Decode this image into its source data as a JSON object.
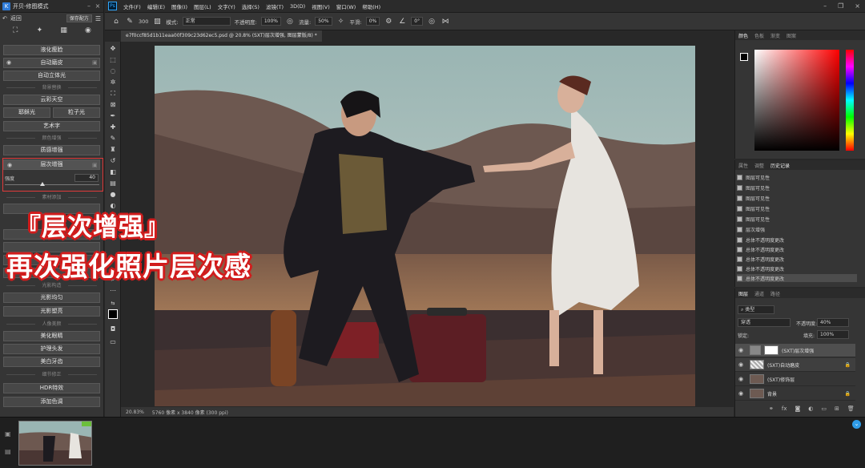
{
  "plugin": {
    "title": "开贝-修图模式",
    "back": "返回",
    "save": "保存配方",
    "buttons": {
      "liquify": "液化瘦脸",
      "skin_smooth": "自动磨皮",
      "auto_3d": "自动立体光",
      "cloud_sky": "云彩天空",
      "glare": "耶稣光",
      "particle": "粒子光",
      "art_text": "艺术字",
      "texture_boost": "质感增强",
      "layer_boost": "层次增强",
      "light_even": "光影均匀",
      "light_shape": "光影塑亮",
      "beautify_eye": "美化眼睛",
      "hair_care": "护理头发",
      "whiten_teeth": "美白牙齿",
      "hdr": "HDR特效",
      "add_tone": "添加色调"
    },
    "sections": {
      "bg": "背景替换",
      "color": "颜色增强",
      "material": "素材添加",
      "light": "光影构造",
      "portrait": "人像美颜",
      "detail": "细节修正"
    },
    "slider": {
      "label": "强度",
      "value": "40",
      "fraction": 0.4
    }
  },
  "ps": {
    "menus": [
      "文件(F)",
      "编辑(E)",
      "图像(I)",
      "图层(L)",
      "文字(Y)",
      "选择(S)",
      "滤镜(T)",
      "3D(D)",
      "视图(V)",
      "窗口(W)",
      "帮助(H)"
    ],
    "options": {
      "mode_label": "模式:",
      "mode_value": "正常",
      "opacity_label": "不透明度:",
      "opacity_value": "100%",
      "flow_label": "流量:",
      "flow_value": "50%",
      "smooth_label": "平滑:",
      "smooth_value": "0%",
      "angle_value": "0°",
      "brush_size": "300"
    },
    "doc_tab": "e7f0ccf85d1b11eaa00f309c23d62ec5.psd @ 20.8% (SXT)层次增强, 图层蒙版/8) *",
    "status": {
      "zoom": "20.83%",
      "size": "5760 像素 x 3840 像素 (300 ppi)"
    }
  },
  "panels": {
    "color_tabs": [
      "颜色",
      "色板",
      "渐变",
      "图案"
    ],
    "history_tabs": [
      "属性",
      "调整",
      "历史记录"
    ],
    "history": [
      "图层可见性",
      "图层可见性",
      "图层可见性",
      "图层可见性",
      "图层可见性",
      "层次增强",
      "总体不透明度更改",
      "总体不透明度更改",
      "总体不透明度更改",
      "总体不透明度更改",
      "总体不透明度更改"
    ],
    "layers_tabs": [
      "图层",
      "通道",
      "路径"
    ],
    "kind": "类型",
    "blend": "穿透",
    "opacity_label": "不透明度:",
    "opacity_value": "40%",
    "lock_label": "锁定:",
    "fill_label": "填充:",
    "fill_value": "100%",
    "layers": [
      "(SXT)层次增强",
      "(SXT)自动磨皮",
      "(SXT)修饰层",
      "背景"
    ]
  },
  "overlay": {
    "line1": "『层次增强』",
    "line2": "再次强化照片层次感"
  },
  "colors": {
    "accent_red": "#e03a3a",
    "ps_blue": "#31a8ff"
  }
}
